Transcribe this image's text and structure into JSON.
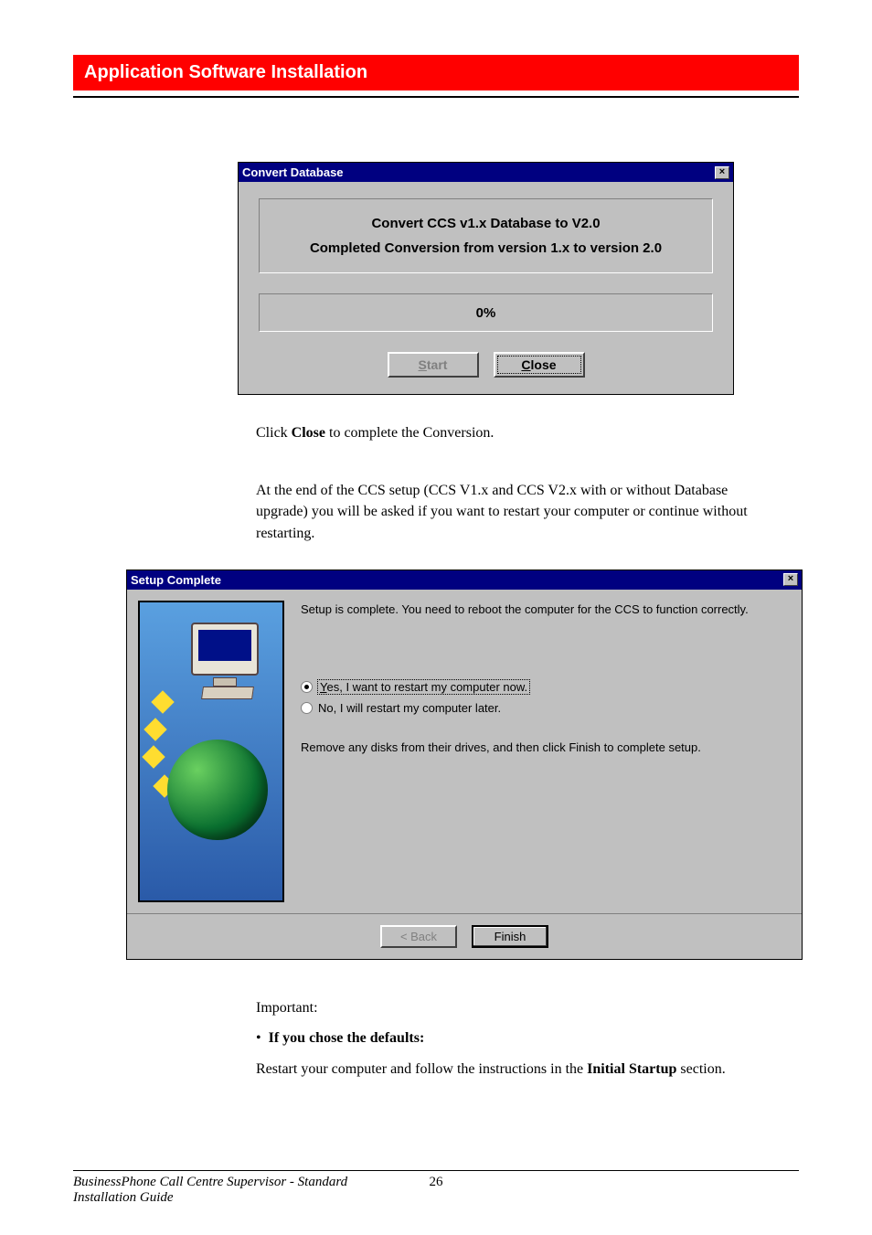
{
  "header": {
    "title": "Application Software Installation"
  },
  "dialog1": {
    "title": "Convert Database",
    "heading1": "Convert CCS v1.x Database to V2.0",
    "heading2": "Completed Conversion from version 1.x to version 2.0",
    "progress_label": "0%",
    "start_label": "Start",
    "close_label": "Close"
  },
  "para1_pre": "Click ",
  "para1_bold": "Close",
  "para1_post": " to complete the Conversion.",
  "para2": "At the end of the CCS setup (CCS V1.x and CCS V2.x with or without Database upgrade) you will be asked if you want to restart your computer or continue without restarting.",
  "dialog2": {
    "title": "Setup Complete",
    "intro": "Setup is complete. You need to reboot the computer for the CCS to function correctly.",
    "radio_yes": "Yes, I want to restart my computer now.",
    "radio_no": "No, I will restart my computer later.",
    "remove_disks": "Remove any disks from their drives, and then click Finish to complete setup.",
    "back_label": "< Back",
    "finish_label": "Finish"
  },
  "after": {
    "important": "Important:",
    "bullet_bold": "If you chose the defaults:",
    "line2_pre": "Restart your computer and follow the instructions in the ",
    "line2_bold": "Initial Startup",
    "line2_post": " section."
  },
  "footer": {
    "line1": "BusinessPhone Call Centre Supervisor - Standard",
    "line2": "Installation Guide",
    "page": "26"
  }
}
